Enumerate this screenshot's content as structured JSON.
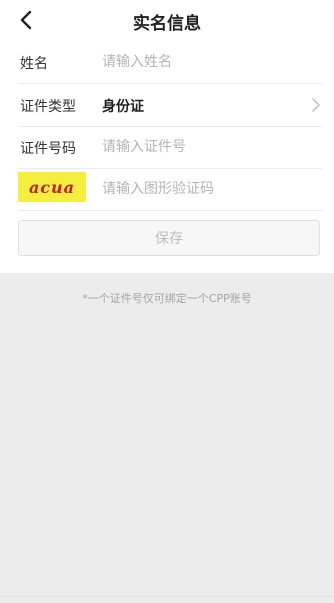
{
  "nav": {
    "title": "实名信息",
    "back_icon": "chevron-left-icon"
  },
  "form": {
    "name": {
      "label": "姓名",
      "placeholder": "请输入姓名",
      "value": ""
    },
    "id_type": {
      "label": "证件类型",
      "value": "身份证",
      "icon": "chevron-right-icon"
    },
    "id_number": {
      "label": "证件号码",
      "placeholder": "请输入证件号",
      "value": ""
    },
    "captcha": {
      "image_text": "acua",
      "image_color": "#f6ee3e",
      "text_color": "#c02020",
      "placeholder": "请输入图形验证码",
      "value": ""
    }
  },
  "actions": {
    "save_label": "保存"
  },
  "notice": "*一个证件号仅可绑定一个CPP账号"
}
